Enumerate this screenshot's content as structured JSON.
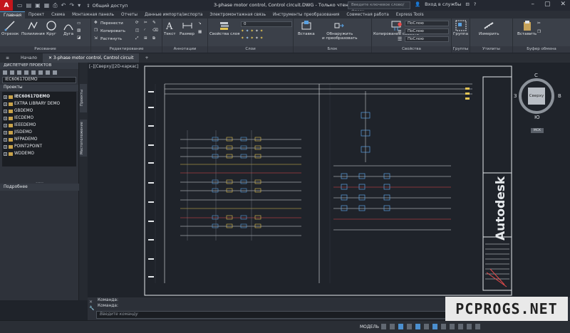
{
  "titlebar": {
    "share": "Общий доступ",
    "document_title": "3-phase motor control, Control circuit.DWG - Только чтение",
    "search_placeholder": "Введите ключевое слово/фразу",
    "sign_in": "Вход в службы"
  },
  "tabs": [
    "Главная",
    "Проект",
    "Схема",
    "Монтажная панель",
    "Отчеты",
    "Данные импорта/экспорта",
    "Электромонтажная связь",
    "Инструменты преобразования",
    "Совместная работа",
    "Express Tools"
  ],
  "ribbon": {
    "draw": {
      "title": "Рисование",
      "line": "Отрезок",
      "polyline": "Полилиния",
      "circle": "Круг",
      "arc": "Дуга"
    },
    "modify": {
      "title": "Редактирование",
      "move": "Перенести",
      "copy": "Копировать",
      "stretch": "Растянуть"
    },
    "annotation": {
      "title": "Аннотации",
      "text": "Текст",
      "dimension": "Размер"
    },
    "layers": {
      "title": "Слои",
      "properties": "Свойства слоя",
      "layer_value": "0"
    },
    "block": {
      "title": "Блок",
      "insert": "Вставка",
      "detect": "Обнаружить",
      "convert": "и преобразовать"
    },
    "properties": {
      "title": "Свойства",
      "match": "Копирование свойств",
      "by_layer_color": "ПоСлою",
      "by_layer_lt": "ПоСлою",
      "by_layer_lw": "ПоСлою"
    },
    "groups": {
      "title": "Группы",
      "group": "Группа"
    },
    "utilities": {
      "title": "Утилиты",
      "measure": "Измерить"
    },
    "clipboard": {
      "title": "Буфер обмена",
      "paste": "Вставить"
    }
  },
  "filetabs": [
    "Начало",
    "3-phase motor control, Control circuit"
  ],
  "project_manager": {
    "header": "ДИСПЕТЧЕР ПРОЕКТОВ",
    "selected": "IEC60617DEMO",
    "projects_label": "Проекты",
    "projects": [
      "IEC60617DEMO",
      "EXTRA LIBRARY DEMO",
      "GBDEMO",
      "IECDEMO",
      "IEEEDEMO",
      "JISDEMO",
      "NFPADEMO",
      "POINT2POINT",
      "WDDEMO"
    ],
    "details_label": "Подробнее",
    "side_tab_projects": "Проекты",
    "side_tab_location": "Местоположение"
  },
  "canvas": {
    "view_label": "[–][Сверху][2D-каркас]",
    "viewcube": {
      "north": "С",
      "south": "Ю",
      "west": "З",
      "east": "В",
      "face": "Сверху",
      "ucs": "МСК"
    },
    "title_block_text": "Autodesk"
  },
  "command": {
    "line1": "Команда:",
    "line2": "Команда:",
    "placeholder": "Введите команду"
  },
  "status": {
    "model": "МОДЕЛЬ"
  },
  "watermark": "PCPROGS.NET"
}
